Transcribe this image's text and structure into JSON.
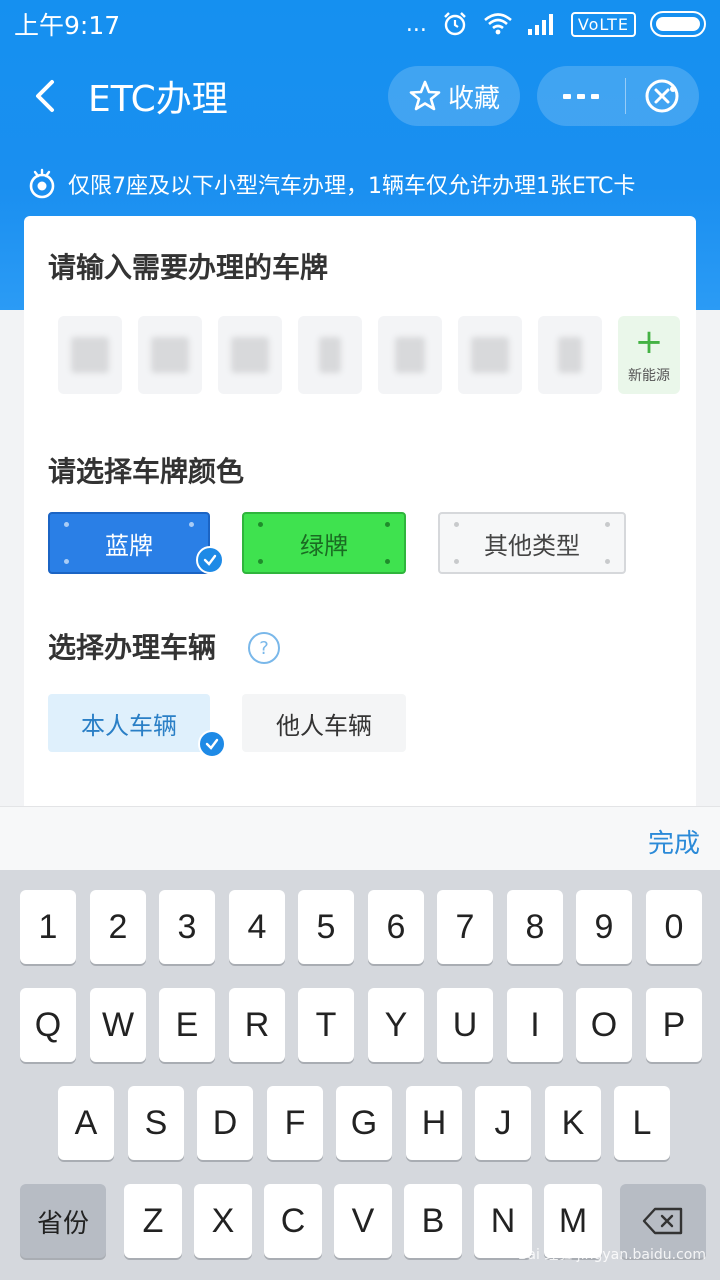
{
  "status_bar": {
    "time": "上午9:17",
    "dots": "...",
    "network": "VoLTE",
    "icons": [
      "alarm-icon",
      "wifi-icon",
      "signal-icon",
      "battery-icon"
    ]
  },
  "nav": {
    "title": "ETC办理",
    "favorite_label": "收藏",
    "icons": [
      "back-arrow-icon",
      "star-icon",
      "more-icon",
      "close-icon"
    ]
  },
  "notice": {
    "text": "仅限7座及以下小型汽车办理，1辆车仅允许办理1张ETC卡",
    "icon": "eye-icon"
  },
  "plate_section": {
    "title": "请输入需要办理的车牌",
    "new_energy_label": "新能源",
    "new_energy_icon": "+"
  },
  "color_section": {
    "title": "请选择车牌颜色",
    "options": [
      {
        "label": "蓝牌",
        "selected": true,
        "color": "#2a7fe6"
      },
      {
        "label": "绿牌",
        "selected": false,
        "color": "#3fe24f"
      },
      {
        "label": "其他类型",
        "selected": false,
        "color": "#f6f7f8"
      }
    ]
  },
  "vehicle_section": {
    "title": "选择办理车辆",
    "help": "?",
    "options": [
      {
        "label": "本人车辆",
        "selected": true
      },
      {
        "label": "他人车辆",
        "selected": false
      }
    ]
  },
  "keyboard": {
    "done_label": "完成",
    "row1": [
      "1",
      "2",
      "3",
      "4",
      "5",
      "6",
      "7",
      "8",
      "9",
      "0"
    ],
    "row2": [
      "Q",
      "W",
      "E",
      "R",
      "T",
      "Y",
      "U",
      "I",
      "O",
      "P"
    ],
    "row3": [
      "A",
      "S",
      "D",
      "F",
      "G",
      "H",
      "J",
      "K",
      "L"
    ],
    "row4": [
      "Z",
      "X",
      "C",
      "V",
      "B",
      "N",
      "M"
    ],
    "province_label": "省份",
    "backspace_icon": "backspace-icon"
  },
  "watermark": "Bai 经验 jingyan.baidu.com",
  "colors": {
    "brand_blue": "#1a8ff0",
    "accent_blue": "#1e8ae6"
  }
}
